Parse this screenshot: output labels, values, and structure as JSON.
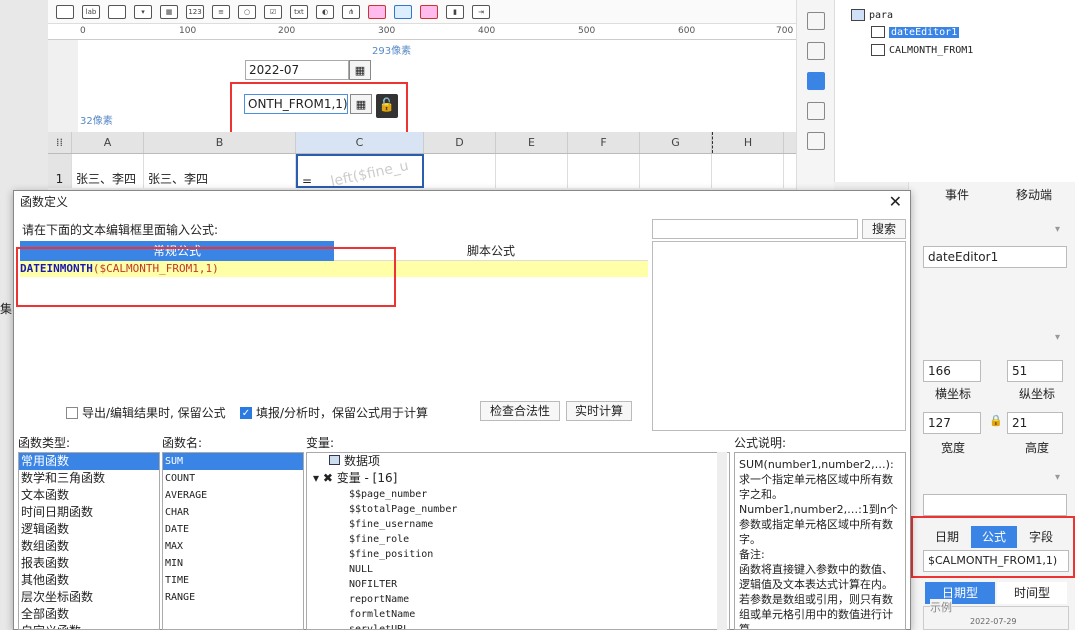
{
  "toolbar": {
    "icons": [
      "textbox-icon",
      "label-icon",
      "button-icon",
      "dropdown-icon",
      "date-icon",
      "number-icon",
      "textarea-icon",
      "radio-icon",
      "checkbox-icon",
      "text-icon",
      "toggle-icon",
      "tree-icon",
      "calendar-red-icon",
      "calendar-blue-icon",
      "calendar-red2-icon",
      "scroll-icon",
      "export-icon"
    ],
    "label_icon_text": "lab",
    "number_icon_text": "123",
    "text_icon_text": "txt"
  },
  "ruler": {
    "ticks": [
      "0",
      "100",
      "200",
      "300",
      "400",
      "500",
      "600",
      "700"
    ]
  },
  "canvas": {
    "width_label": "293像素",
    "height_label": "32像素",
    "date_value": "2022-07",
    "formula_widget_value": "ONTH_FROM1,1)"
  },
  "grid": {
    "columns": [
      "A",
      "B",
      "C",
      "D",
      "E",
      "F",
      "G",
      "H"
    ],
    "row_number": "1",
    "cells": [
      "张三、李四",
      "张三、李四",
      "=",
      "",
      "",
      "",
      "",
      ""
    ],
    "watermark": "left($fine_u"
  },
  "tree": {
    "root": "para",
    "items": [
      "dateEditor1",
      "CALMONTH_FROM1"
    ]
  },
  "props": {
    "tabs": [
      "事件",
      "移动端"
    ],
    "name_value": "dateEditor1",
    "x_value": "166",
    "y_value": "51",
    "x_label": "横坐标",
    "y_label": "纵坐标",
    "width_value": "127",
    "height_value": "21",
    "width_label": "宽度",
    "height_label": "高度",
    "seg_options": [
      "日期",
      "公式",
      "字段"
    ],
    "seg_selected": "公式",
    "formula_value": "$CALMONTH_FROM1,1)",
    "type_options": [
      "日期型",
      "时间型"
    ],
    "sample_label": "示例",
    "sample_value": "2022-07-29"
  },
  "dialog": {
    "title": "函数定义",
    "prompt": "请在下面的文本编辑框里面输入公式:",
    "search_placeholder": "",
    "search_button": "搜索",
    "tabs": [
      "常规公式",
      "脚本公式"
    ],
    "formula_func": "DATEINMONTH",
    "formula_args": "($CALMONTH_FROM1,1)",
    "export_keep": "导出/编辑结果时, 保留公式",
    "fill_keep": "填报/分析时，保留公式用于计算",
    "check_button": "检查合法性",
    "realtime_button": "实时计算",
    "func_type_label": "函数类型:",
    "func_name_label": "函数名:",
    "var_label": "变量:",
    "desc_label": "公式说明:",
    "func_types": [
      "常用函数",
      "数学和三角函数",
      "文本函数",
      "时间日期函数",
      "逻辑函数",
      "数组函数",
      "报表函数",
      "其他函数",
      "层次坐标函数",
      "全部函数",
      "自定义函数"
    ],
    "func_names": [
      "SUM",
      "COUNT",
      "AVERAGE",
      "CHAR",
      "DATE",
      "MAX",
      "MIN",
      "TIME",
      "RANGE"
    ],
    "var_data_item": "数据项",
    "var_group": "变量 - [16]",
    "variables": [
      "$$page_number",
      "$$totalPage_number",
      "$fine_username",
      "$fine_role",
      "$fine_position",
      "NULL",
      "NOFILTER",
      "reportName",
      "formletName",
      "servletURL"
    ],
    "description": "SUM(number1,number2,…):求一个指定单元格区域中所有数字之和。\nNumber1,number2,…:1到n个参数或指定单元格区域中所有数字。\n备注:\n函数将直接键入参数中的数值、逻辑值及文本表达式计算在内。若参数是数组或引用，则只有数组或单元格引用中的数值进行计算。"
  },
  "side_label": "集"
}
